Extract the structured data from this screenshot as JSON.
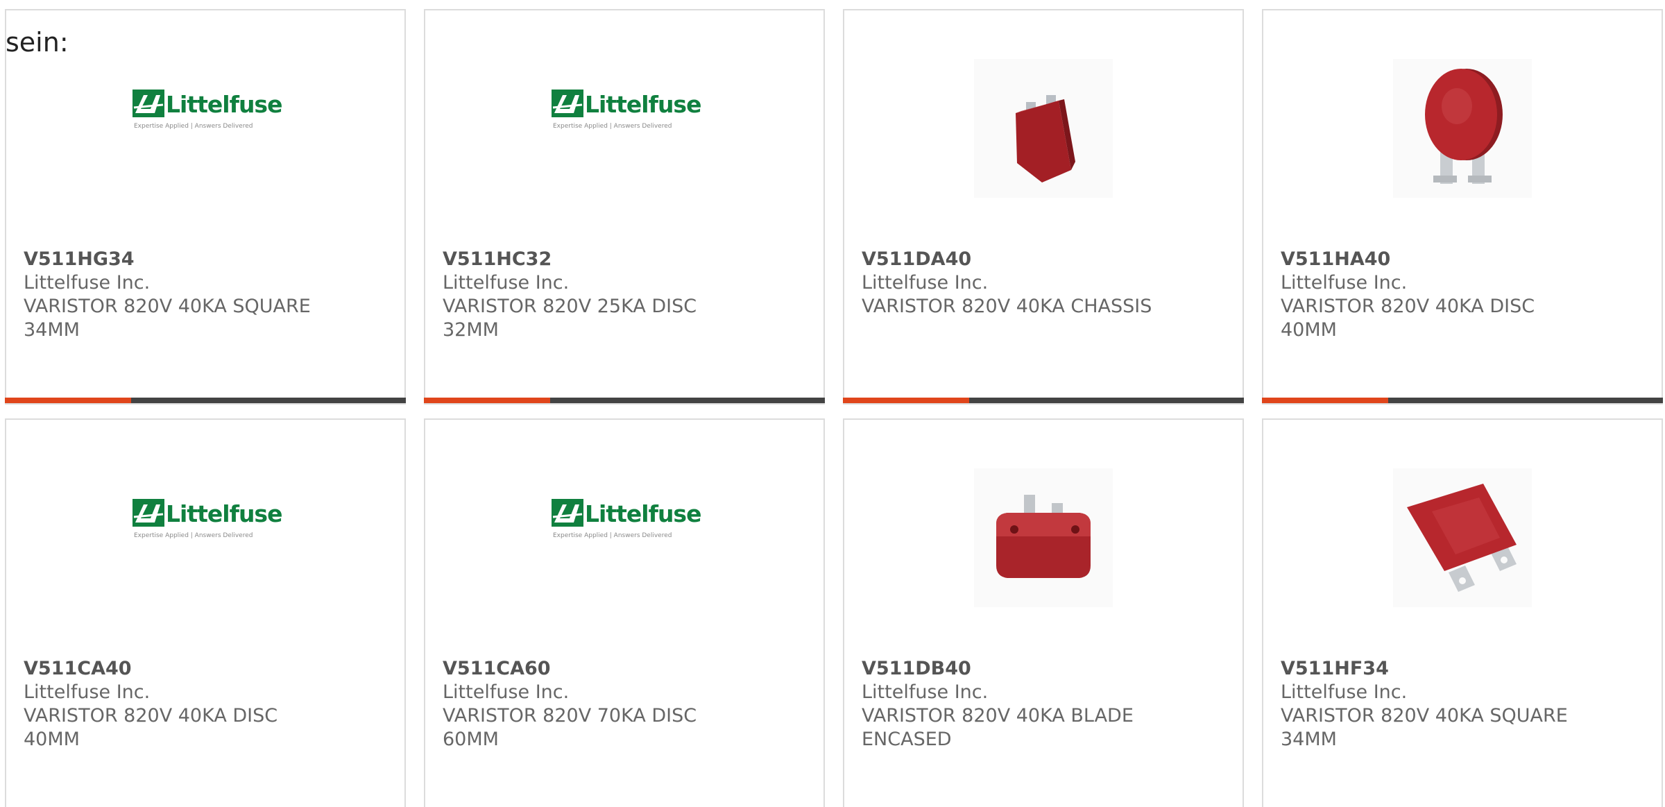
{
  "intro_text": "sein:",
  "colors": {
    "accent_bar": "#e0451b",
    "dark_bar": "#434343",
    "logo_green": "#10803f",
    "varistor_red": "#b3252a"
  },
  "logo": {
    "word": "Littelfuse",
    "tagline": "Expertise Applied | Answers Delivered"
  },
  "products": [
    {
      "part": "V511HG34",
      "maker": "Littelfuse Inc.",
      "desc": "VARISTOR 820V 40KA SQUARE 34MM",
      "image": "littelfuse-logo"
    },
    {
      "part": "V511HC32",
      "maker": "Littelfuse Inc.",
      "desc": "VARISTOR 820V 25KA DISC 32MM",
      "image": "littelfuse-logo"
    },
    {
      "part": "V511DA40",
      "maker": "Littelfuse Inc.",
      "desc": "VARISTOR 820V 40KA CHASSIS",
      "image": "chassis-varistor"
    },
    {
      "part": "V511HA40",
      "maker": "Littelfuse Inc.",
      "desc": "VARISTOR 820V 40KA DISC 40MM",
      "image": "disc-varistor"
    },
    {
      "part": "V511CA40",
      "maker": "Littelfuse Inc.",
      "desc": "VARISTOR 820V 40KA DISC 40MM",
      "image": "littelfuse-logo"
    },
    {
      "part": "V511CA60",
      "maker": "Littelfuse Inc.",
      "desc": "VARISTOR 820V 70KA DISC 60MM",
      "image": "littelfuse-logo"
    },
    {
      "part": "V511DB40",
      "maker": "Littelfuse Inc.",
      "desc": "VARISTOR 820V 40KA BLADE ENCASED",
      "image": "block-varistor"
    },
    {
      "part": "V511HF34",
      "maker": "Littelfuse Inc.",
      "desc": "VARISTOR 820V 40KA SQUARE 34MM",
      "image": "square-varistor"
    }
  ]
}
